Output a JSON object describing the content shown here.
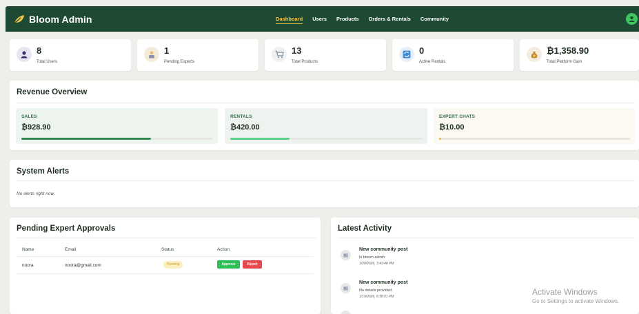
{
  "brand": {
    "name": "Bloom Admin",
    "logo_icon": "leaf-icon"
  },
  "nav": {
    "items": [
      {
        "label": "Dashboard",
        "active": true
      },
      {
        "label": "Users"
      },
      {
        "label": "Products"
      },
      {
        "label": "Orders & Rentals"
      },
      {
        "label": "Community"
      }
    ],
    "user_icon": "user-circle-icon"
  },
  "stats": [
    {
      "value": "8",
      "label": "Total Users",
      "icon": "user-icon"
    },
    {
      "value": "1",
      "label": "Pending Experts",
      "icon": "expert-icon"
    },
    {
      "value": "13",
      "label": "Total Products",
      "icon": "cart-icon"
    },
    {
      "value": "0",
      "label": "Active Rentals",
      "icon": "refresh-icon"
    },
    {
      "value": "₿1,358.90",
      "label": "Total Platform Gain",
      "icon": "money-bag-icon"
    }
  ],
  "revenue": {
    "title": "Revenue Overview",
    "items": [
      {
        "label": "SALES",
        "value": "₿928.90",
        "progress": 0.68,
        "color": "#2f8a52"
      },
      {
        "label": "RENTALS",
        "value": "₿420.00",
        "progress": 0.31,
        "color": "#5ccf86"
      },
      {
        "label": "EXPERT CHATS",
        "value": "₿10.00",
        "progress": 0.01,
        "color": "#f2b23f"
      }
    ]
  },
  "alerts": {
    "title": "System Alerts",
    "empty_text": "No alerts right now."
  },
  "approvals": {
    "title": "Pending Expert Approvals",
    "columns": [
      "Name",
      "Email",
      "Status",
      "Action"
    ],
    "rows": [
      {
        "name": "noora",
        "email": "noora@gmail.com",
        "status": "Pending",
        "approve_label": "Approve",
        "reject_label": "Reject"
      }
    ]
  },
  "activity": {
    "title": "Latest Activity",
    "items": [
      {
        "title": "New community post",
        "detail": "hi bloom admin",
        "time": "1/20/2026, 3:43:48 PM",
        "icon": "post-icon"
      },
      {
        "title": "New community post",
        "detail": "No details provided.",
        "time": "1/19/2026, 6:58:01 PM",
        "icon": "post-icon"
      }
    ]
  },
  "watermark": {
    "title": "Activate Windows",
    "subtitle": "Go to Settings to activate Windows."
  },
  "colors": {
    "nav_bg": "#1e4a33",
    "accent": "#f2c44a",
    "approve": "#2fbd57",
    "reject": "#e5484d"
  }
}
